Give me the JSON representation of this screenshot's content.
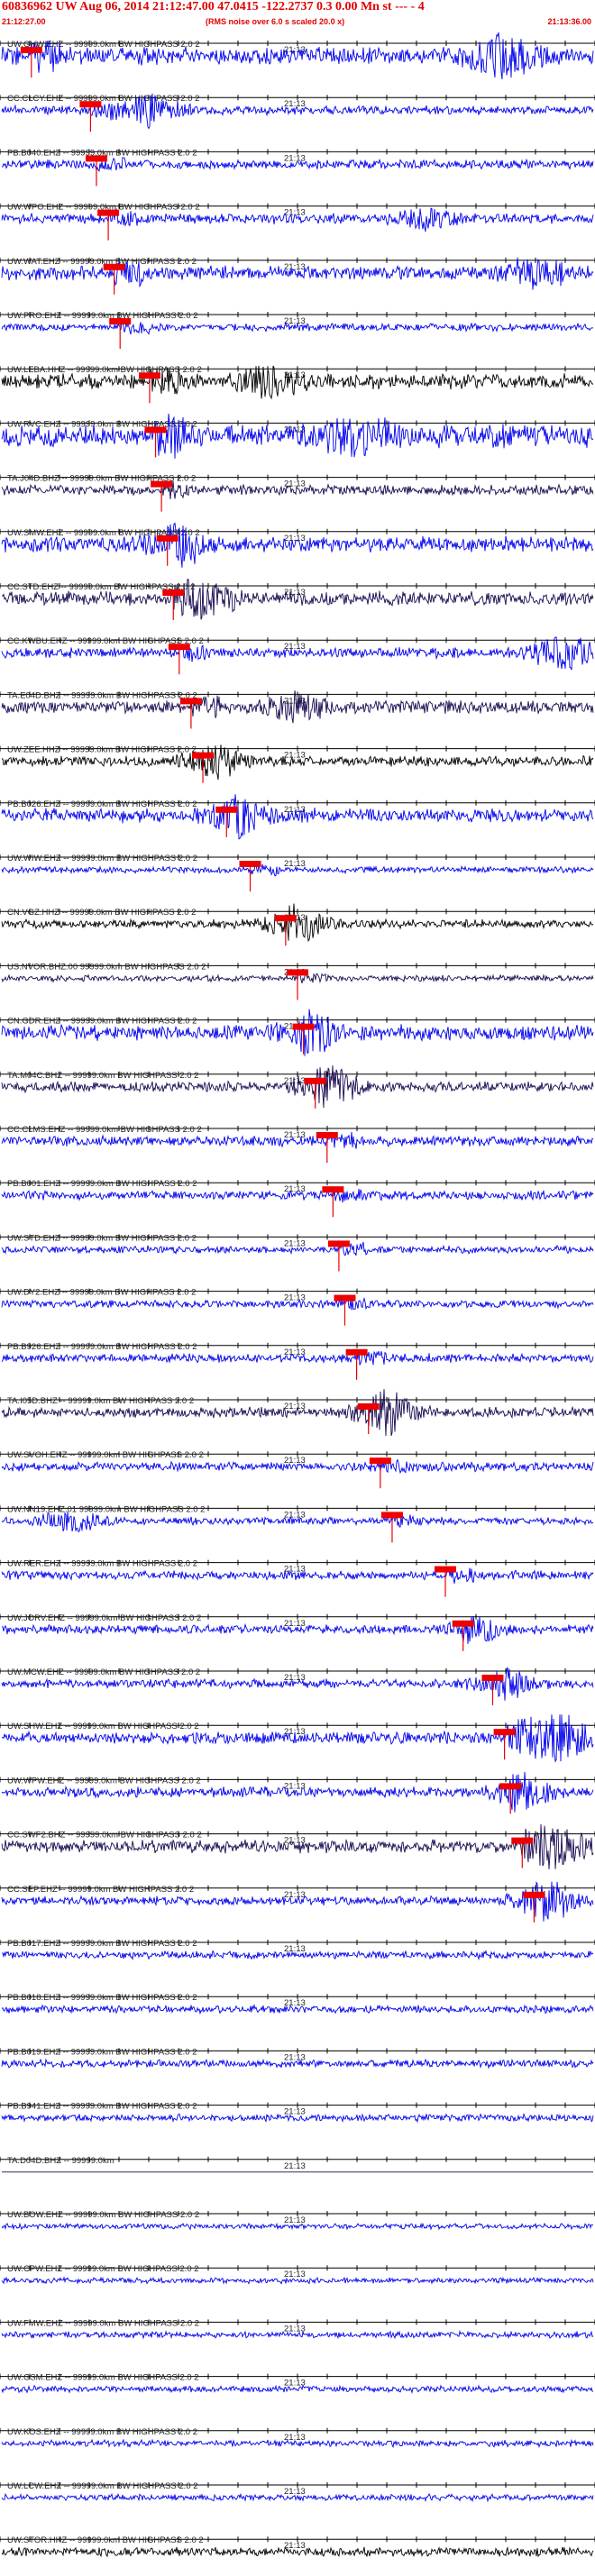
{
  "header": {
    "title": "60836962 UW Aug 06, 2014 21:12:47.00   47.0415 -122.2737  0.3 0.00 Mn st --- - 4",
    "subtitle": "(RMS noise over 6.0 s scaled 20.0 x)",
    "start_time": "21:12:27.00",
    "end_time": "21:13:36.00"
  },
  "minute_label": "21:13",
  "colors": {
    "blue": "#0000ee",
    "dark": "#1a0a50",
    "black": "#000000",
    "red": "#ee0000"
  },
  "channels": [
    {
      "label": "UW.GHW.EHZ -- 99999.0km BW  HIGHPASS  2.0  2",
      "amp": 0.7,
      "color": "blue",
      "pick": 0.05,
      "ev": 0.85,
      "evAmp": 1.0
    },
    {
      "label": "CC.CLCY.EHZ -- 99999.0km BW  HIGHPASS  2.0  2",
      "amp": 0.35,
      "color": "blue",
      "pick": 0.15,
      "ev": 0.25,
      "evAmp": 0.9
    },
    {
      "label": "PB.B040.EHZ -- 99999.0km BW  HIGHPASS  2.0  2",
      "amp": 0.35,
      "color": "blue",
      "pick": 0.16,
      "ev": -1,
      "evAmp": 0
    },
    {
      "label": "UW.WPO.EHZ -- 99999.0km BW  HIGHPASS  2.0  2",
      "amp": 0.4,
      "color": "blue",
      "pick": 0.18,
      "ev": 0.72,
      "evAmp": 0.5
    },
    {
      "label": "UW.WAT.EHZ -- 99999.0km BW  HIGHPASS  2.0  2",
      "amp": 0.55,
      "color": "blue",
      "pick": 0.19,
      "ev": 0.9,
      "evAmp": 0.7
    },
    {
      "label": "UW.PRO.EHZ -- 99999.0km BW  HIGHPASS  2.0  2",
      "amp": 0.3,
      "color": "blue",
      "pick": 0.2,
      "ev": -1,
      "evAmp": 0
    },
    {
      "label": "UW.LEBA.HHZ -- 99999.0km BW  HIGHPASS  2.0  2",
      "amp": 0.6,
      "color": "black",
      "pick": 0.25,
      "ev": 0.45,
      "evAmp": 0.8
    },
    {
      "label": "UW.RVC.EHZ -- 99999.0km BW  HIGHPASS  2.0  2",
      "amp": 0.9,
      "color": "blue",
      "pick": 0.26,
      "ev": 0.6,
      "evAmp": 1.0
    },
    {
      "label": "TA.J04D.BHZ -- 99999.0km BW  HIGHPASS  2.0  2",
      "amp": 0.4,
      "color": "dark",
      "pick": 0.27,
      "ev": -1,
      "evAmp": 0
    },
    {
      "label": "UW.SMW.EHZ -- 99999.0km BW  HIGHPASS  2.0  2",
      "amp": 0.6,
      "color": "blue",
      "pick": 0.28,
      "ev": 0.3,
      "evAmp": 0.6
    },
    {
      "label": "CC.STD.EHZ -- 99999.0km BW  HIGHPASS  2.0  2",
      "amp": 0.55,
      "color": "dark",
      "pick": 0.29,
      "ev": 0.35,
      "evAmp": 0.7
    },
    {
      "label": "CC.KWBU.EHZ -- 99999.0km BW  HIGHPASS  2.0  2",
      "amp": 0.4,
      "color": "blue",
      "pick": 0.3,
      "ev": 0.95,
      "evAmp": 0.9
    },
    {
      "label": "TA.E04D.BHZ -- 99999.0km BW  HIGHPASS  2.0  2",
      "amp": 0.5,
      "color": "dark",
      "pick": 0.32,
      "ev": 0.5,
      "evAmp": 0.7
    },
    {
      "label": "UW.ZEE.HHZ -- 99999.0km BW  HIGHPASS  2.0  2",
      "amp": 0.4,
      "color": "black",
      "pick": 0.34,
      "ev": 0.36,
      "evAmp": 0.6
    },
    {
      "label": "PB.B026.EHZ -- 99999.0km BW  HIGHPASS  2.0  2",
      "amp": 0.55,
      "color": "blue",
      "pick": 0.38,
      "ev": 0.4,
      "evAmp": 0.7
    },
    {
      "label": "UW.WIW.EHZ -- 99999.0km BW  HIGHPASS  2.0  2",
      "amp": 0.25,
      "color": "blue",
      "pick": 0.42,
      "ev": -1,
      "evAmp": 0
    },
    {
      "label": "CN.VGZ.HHZ -- 99999.0km BW  HIGHPASS  2.0  2",
      "amp": 0.35,
      "color": "black",
      "pick": 0.48,
      "ev": 0.5,
      "evAmp": 0.8
    },
    {
      "label": "US.NVOR.BHZ.00 99999.0km BW  HIGHPASS  2.0  2",
      "amp": 0.25,
      "color": "dark",
      "pick": 0.5,
      "ev": -1,
      "evAmp": 0
    },
    {
      "label": "CN.GDR.EHZ -- 99999.0km BW  HIGHPASS  2.0  2",
      "amp": 0.6,
      "color": "blue",
      "pick": 0.51,
      "ev": 0.52,
      "evAmp": 0.9
    },
    {
      "label": "TA.M04C.BHZ -- 99999.0km BW  HIGHPASS  2.0  2",
      "amp": 0.4,
      "color": "dark",
      "pick": 0.53,
      "ev": 0.55,
      "evAmp": 0.9
    },
    {
      "label": "CC.CLMS.EHZ -- 99999.0km BW  HIGHPASS  2.0  2",
      "amp": 0.4,
      "color": "blue",
      "pick": 0.55,
      "ev": -1,
      "evAmp": 0
    },
    {
      "label": "PB.B001.EHZ -- 99999.0km BW  HIGHPASS  2.0  2",
      "amp": 0.35,
      "color": "blue",
      "pick": 0.56,
      "ev": -1,
      "evAmp": 0
    },
    {
      "label": "UW.STD.EHZ -- 99999.0km BW  HIGHPASS  2.0  2",
      "amp": 0.3,
      "color": "blue",
      "pick": 0.57,
      "ev": -1,
      "evAmp": 0
    },
    {
      "label": "UW.DY2.EHZ -- 99999.0km BW  HIGHPASS  2.0  2",
      "amp": 0.3,
      "color": "blue",
      "pick": 0.58,
      "ev": -1,
      "evAmp": 0
    },
    {
      "label": "PB.B926.EHZ -- 99999.0km BW  HIGHPASS  2.0  2",
      "amp": 0.35,
      "color": "blue",
      "pick": 0.6,
      "ev": -1,
      "evAmp": 0
    },
    {
      "label": "TA.I05D.BHZ -- 99999.0km BW  HIGHPASS  2.0  2",
      "amp": 0.4,
      "color": "dark",
      "pick": 0.62,
      "ev": 0.65,
      "evAmp": 0.9
    },
    {
      "label": "UW.SVOH.EHZ -- 99999.0km BW  HIGHPASS  2.0  2",
      "amp": 0.35,
      "color": "blue",
      "pick": 0.64,
      "ev": -1,
      "evAmp": 0
    },
    {
      "label": "UW.NN19.EHZ.01 99999.0km BW  HIGHPASS  2.0  2",
      "amp": 0.3,
      "color": "blue",
      "pick": 0.66,
      "ev": 0.12,
      "evAmp": 0.5
    },
    {
      "label": "UW.RER.EHZ -- 99999.0km BW  HIGHPASS  2.0  2",
      "amp": 0.35,
      "color": "blue",
      "pick": 0.75,
      "ev": -1,
      "evAmp": 0
    },
    {
      "label": "UW.JORV.EHZ -- 99999.0km BW  HIGHPASS  2.0  2",
      "amp": 0.35,
      "color": "blue",
      "pick": 0.78,
      "ev": 0.8,
      "evAmp": 0.4
    },
    {
      "label": "UW.MCW.EHZ -- 99999.0km BW  HIGHPASS  2.0  2",
      "amp": 0.35,
      "color": "blue",
      "pick": 0.83,
      "ev": 0.85,
      "evAmp": 0.6
    },
    {
      "label": "UW.SHW.EHZ -- 99999.0km BW  HIGHPASS  2.0  2",
      "amp": 0.45,
      "color": "blue",
      "pick": 0.85,
      "ev": 0.93,
      "evAmp": 1.6
    },
    {
      "label": "UW.WPW.EHZ -- 99999.0km BW  HIGHPASS  2.0  2",
      "amp": 0.4,
      "color": "blue",
      "pick": 0.86,
      "ev": 0.88,
      "evAmp": 0.8
    },
    {
      "label": "CC.SWF2.BHZ -- 99999.0km BW  HIGHPASS  2.0  2",
      "amp": 0.5,
      "color": "dark",
      "pick": 0.88,
      "ev": 0.94,
      "evAmp": 1.0
    },
    {
      "label": "CC.SEP.EHZ -- 99999.0km BW  HIGHPASS  2.0  2",
      "amp": 0.35,
      "color": "blue",
      "pick": 0.9,
      "ev": 0.92,
      "evAmp": 0.9
    },
    {
      "label": "PB.B017.EHZ -- 99999.0km BW  HIGHPASS  2.0  2",
      "amp": 0.3,
      "color": "blue",
      "pick": -1,
      "ev": -1,
      "evAmp": 0
    },
    {
      "label": "PB.B018.EHZ -- 99999.0km BW  HIGHPASS  2.0  2",
      "amp": 0.3,
      "color": "blue",
      "pick": -1,
      "ev": -1,
      "evAmp": 0
    },
    {
      "label": "PB.B019.EHZ -- 99999.0km BW  HIGHPASS  2.0  2",
      "amp": 0.3,
      "color": "blue",
      "pick": -1,
      "ev": -1,
      "evAmp": 0
    },
    {
      "label": "PB.B941.EHZ -- 99999.0km BW  HIGHPASS  2.0  2",
      "amp": 0.28,
      "color": "blue",
      "pick": -1,
      "ev": -1,
      "evAmp": 0
    },
    {
      "label": "TA.D04D.BHZ -- 99999.0km",
      "amp": 0.0,
      "color": "dark",
      "pick": -1,
      "ev": -1,
      "evAmp": 0
    },
    {
      "label": "UW.BOW.EHZ -- 99999.0km BW  HIGHPASS  2.0  2",
      "amp": 0.22,
      "color": "blue",
      "pick": -1,
      "ev": -1,
      "evAmp": 0
    },
    {
      "label": "UW.CPW.EHZ -- 99999.0km BW  HIGHPASS  2.0  2",
      "amp": 0.22,
      "color": "blue",
      "pick": -1,
      "ev": -1,
      "evAmp": 0
    },
    {
      "label": "UW.FMW.EHZ -- 99999.0km BW  HIGHPASS  2.0  2",
      "amp": 0.25,
      "color": "blue",
      "pick": -1,
      "ev": -1,
      "evAmp": 0
    },
    {
      "label": "UW.GSM.EHZ -- 99999.0km BW  HIGHPASS  2.0  2",
      "amp": 0.25,
      "color": "blue",
      "pick": -1,
      "ev": -1,
      "evAmp": 0
    },
    {
      "label": "UW.KOS.EHZ -- 99999.0km BW  HIGHPASS  2.0  2",
      "amp": 0.25,
      "color": "blue",
      "pick": -1,
      "ev": -1,
      "evAmp": 0
    },
    {
      "label": "UW.LCW.EHZ -- 99999.0km BW  HIGHPASS  2.0  2",
      "amp": 0.25,
      "color": "blue",
      "pick": -1,
      "ev": -1,
      "evAmp": 0
    },
    {
      "label": "UW.STOR.HHZ -- 99999.0km BW  HIGHPASS  2.0  2",
      "amp": 0.35,
      "color": "black",
      "pick": -1,
      "ev": -1,
      "evAmp": 0
    }
  ]
}
